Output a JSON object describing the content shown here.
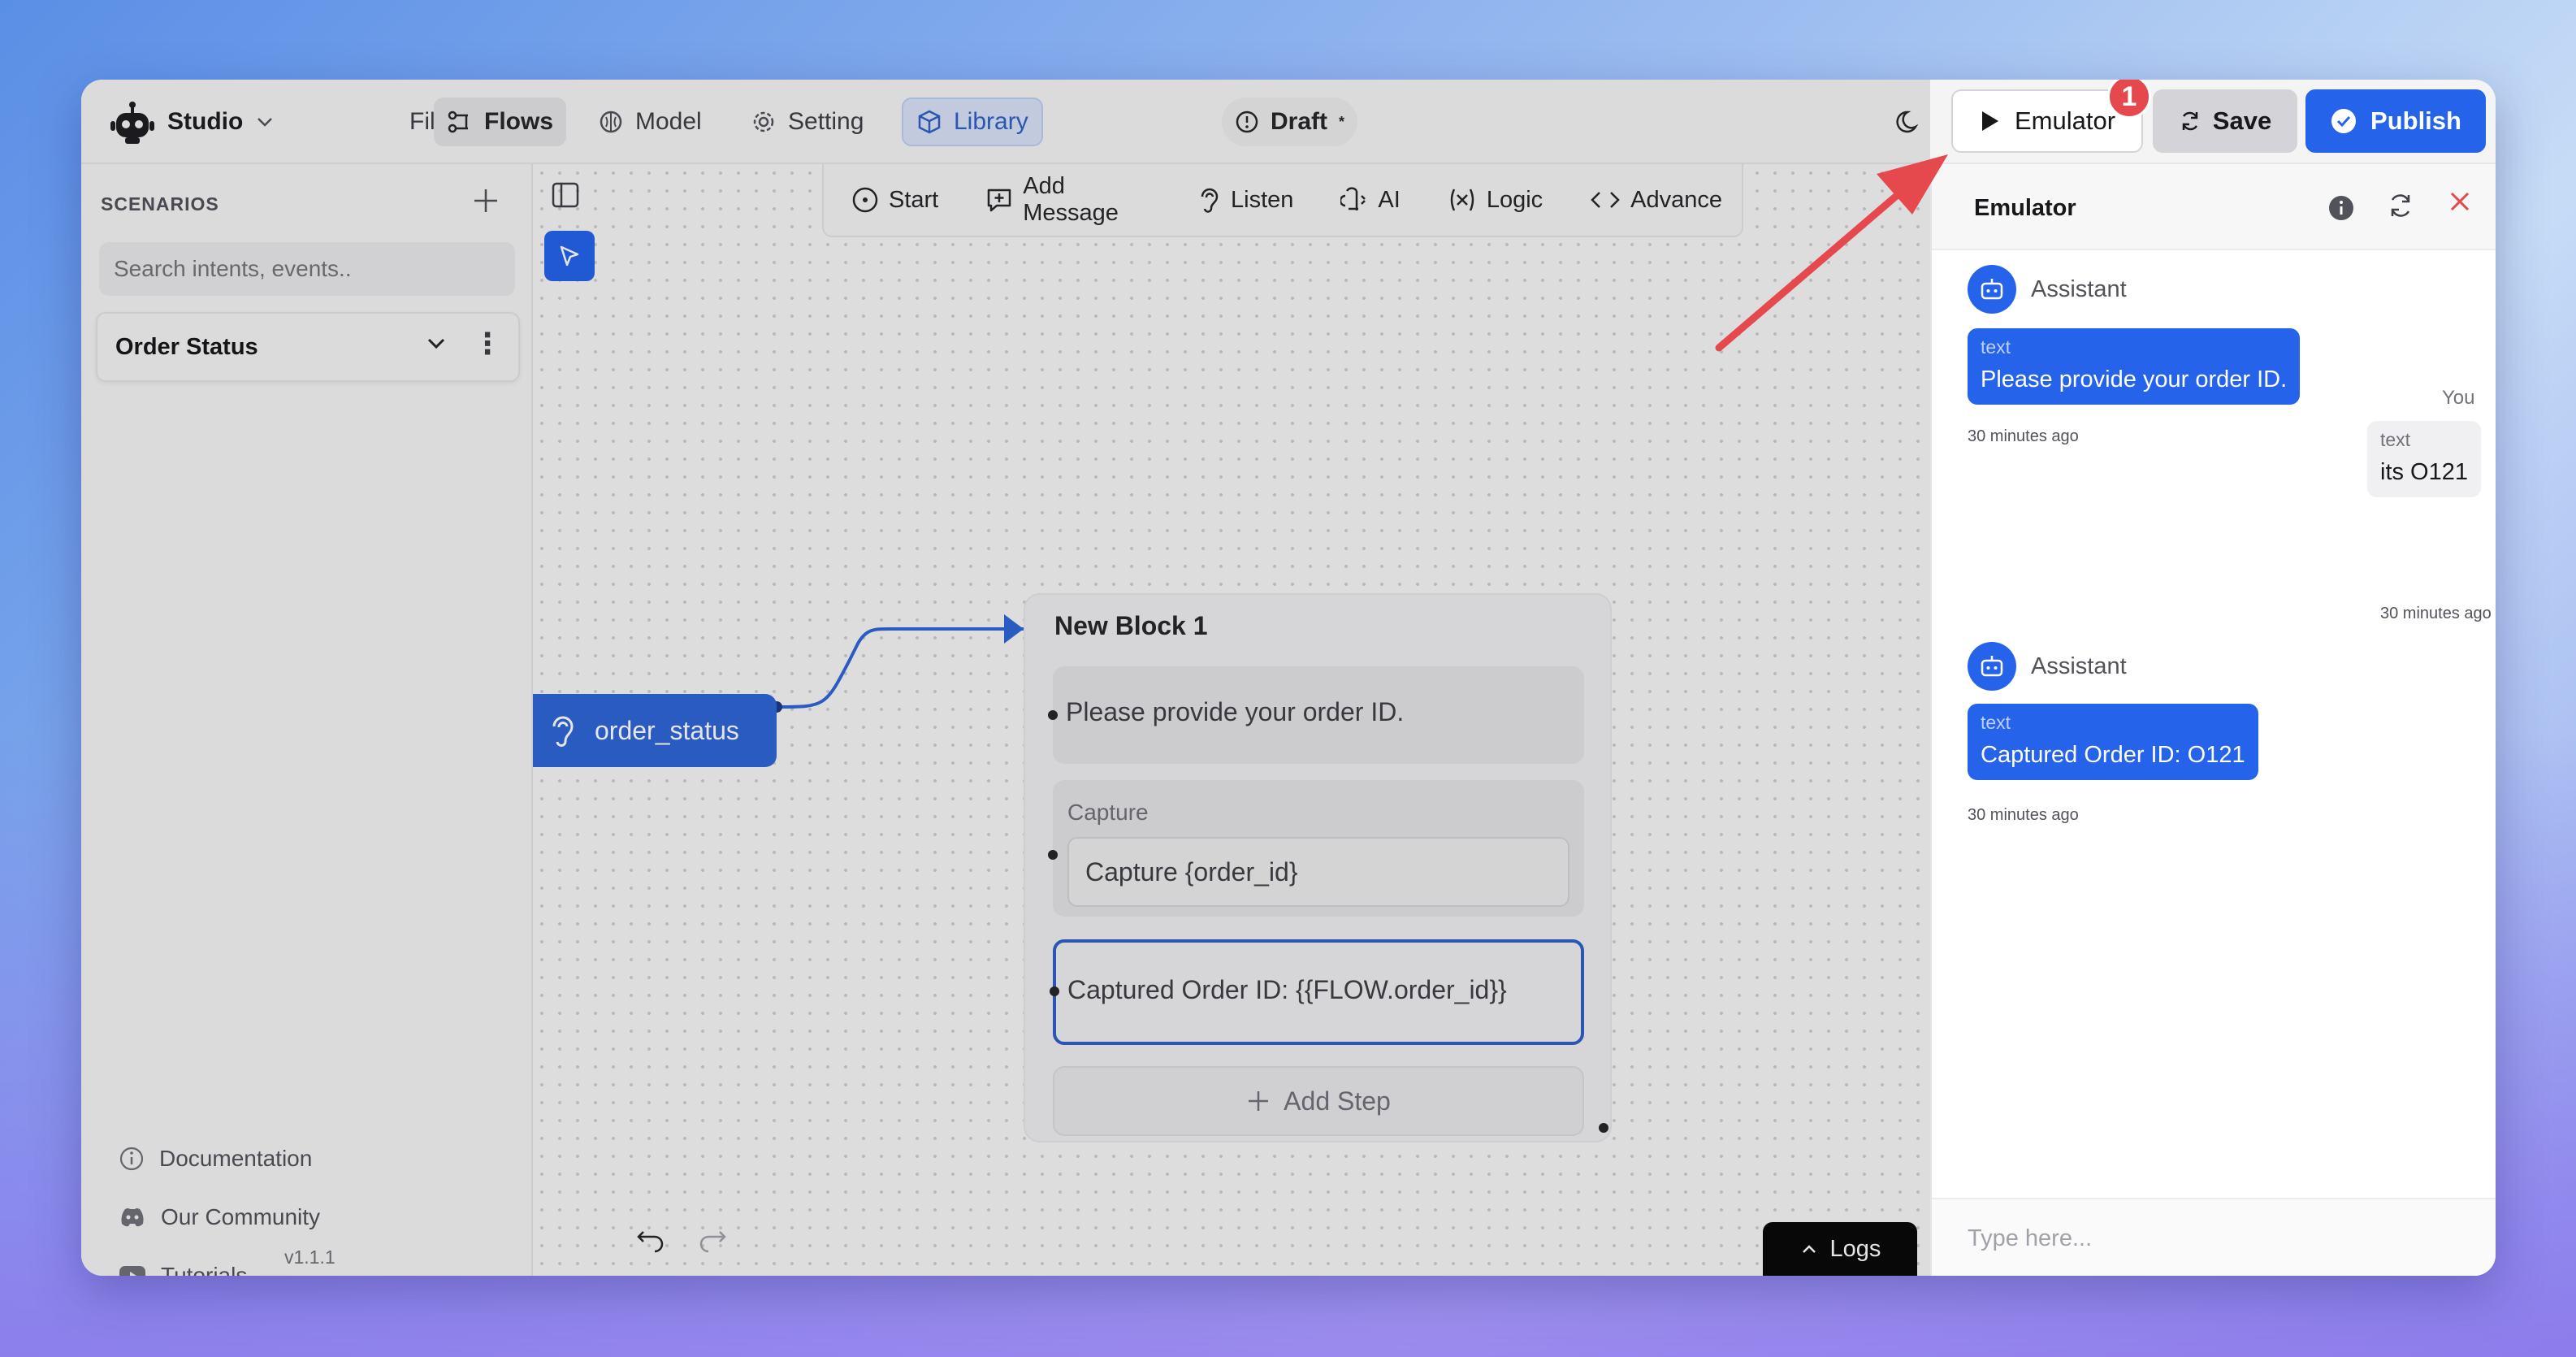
{
  "topbar": {
    "studio_label": "Studio",
    "menu": [
      {
        "label": "File",
        "icon": "chevron-down-icon"
      },
      {
        "label": "Flows",
        "icon": "flows-icon"
      },
      {
        "label": "Model",
        "icon": "brain-icon"
      },
      {
        "label": "Setting",
        "icon": "gear-icon"
      },
      {
        "label": "Library",
        "icon": "cube-icon"
      }
    ],
    "draft_label": "Draft",
    "draft_marker": "*",
    "emulator_label": "Emulator",
    "save_label": "Save",
    "publish_label": "Publish",
    "badge_count": "1",
    "accent_color": "#2563eb"
  },
  "sidebar": {
    "title": "SCENARIOS",
    "search_placeholder": "Search intents, events..",
    "scenario": "Order Status",
    "links": [
      "Documentation",
      "Our Community",
      "Tutorials"
    ],
    "version": "v1.1.1"
  },
  "canvas": {
    "tools": [
      "Start",
      "Add Message",
      "Listen",
      "AI",
      "Logic",
      "Advance"
    ],
    "intent_node": "order_status",
    "block": {
      "title": "New Block 1",
      "message_step": "Please provide your order ID.",
      "capture_label": "Capture",
      "capture_value": "Capture {order_id}",
      "selected_step": "Captured Order ID: {{FLOW.order_id}}",
      "add_step_label": "Add Step"
    },
    "logs_label": "Logs"
  },
  "emulator": {
    "title": "Emulator",
    "messages": [
      {
        "role": "Assistant",
        "type": "text",
        "text": "Please provide your order ID.",
        "time": "30 minutes ago"
      },
      {
        "role": "You",
        "type": "text",
        "text": "its O121",
        "time": "30 minutes ago"
      },
      {
        "role": "Assistant",
        "type": "text",
        "text": "Captured Order ID: O121",
        "time": "30 minutes ago"
      }
    ],
    "input_placeholder": "Type here..."
  }
}
